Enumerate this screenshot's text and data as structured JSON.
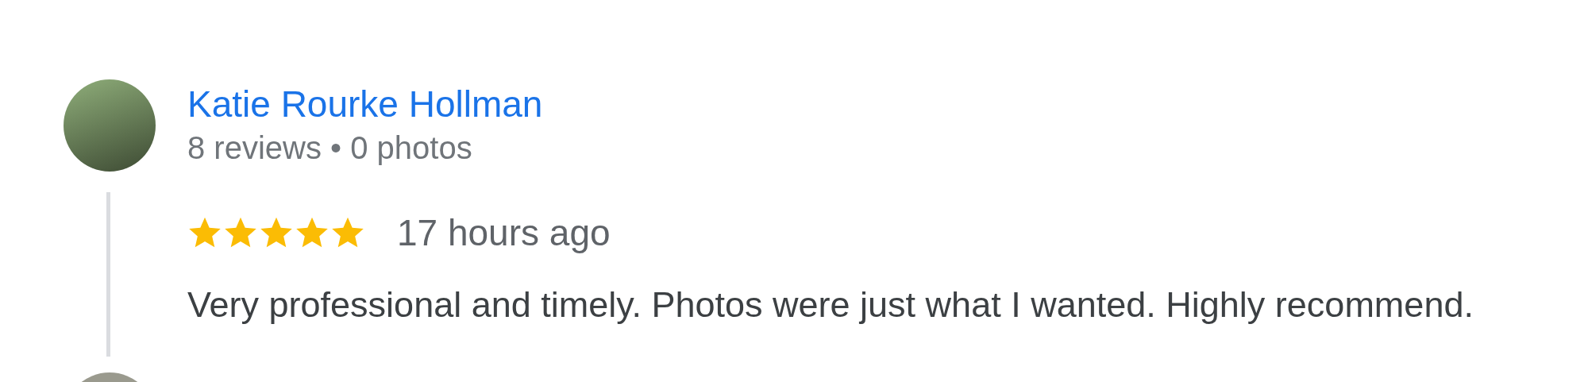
{
  "review": {
    "name": "Katie Rourke Hollman",
    "meta": "8 reviews • 0 photos",
    "stars": 5,
    "time": "17 hours ago",
    "text": "Very professional and timely. Photos were just what I wanted. Highly recommend."
  }
}
